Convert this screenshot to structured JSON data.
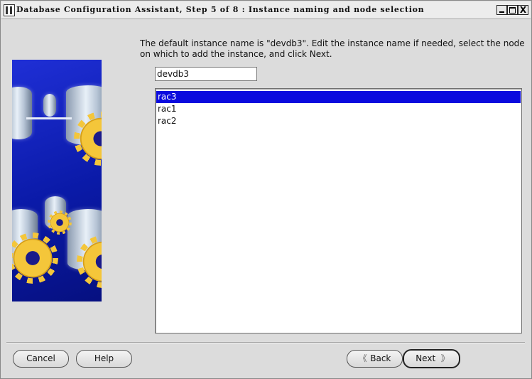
{
  "window": {
    "title": "Database Configuration Assistant, Step 5 of 8 : Instance naming and node selection",
    "controls": {
      "minimize": "_",
      "maximize": "□",
      "close": "X"
    }
  },
  "main": {
    "instruction": "The default instance name is \"devdb3\". Edit the instance name if needed, select the node on which to add the instance, and click Next.",
    "instance_name": "devdb3",
    "nodes": [
      {
        "label": "rac3",
        "selected": true
      },
      {
        "label": "rac1",
        "selected": false
      },
      {
        "label": "rac2",
        "selected": false
      }
    ]
  },
  "footer": {
    "cancel_label": "Cancel",
    "help_label": "Help",
    "back_label": "Back",
    "next_label": "Next",
    "back_chevron": "《",
    "next_chevron": "》"
  },
  "colors": {
    "selection": "#0a0ade",
    "graphic_blue": "#1f2fd6",
    "gear_gold": "#f4c63a"
  },
  "icons": [
    "app-icon",
    "database-gear-graphic",
    "back-chevron-icon",
    "next-chevron-icon"
  ]
}
